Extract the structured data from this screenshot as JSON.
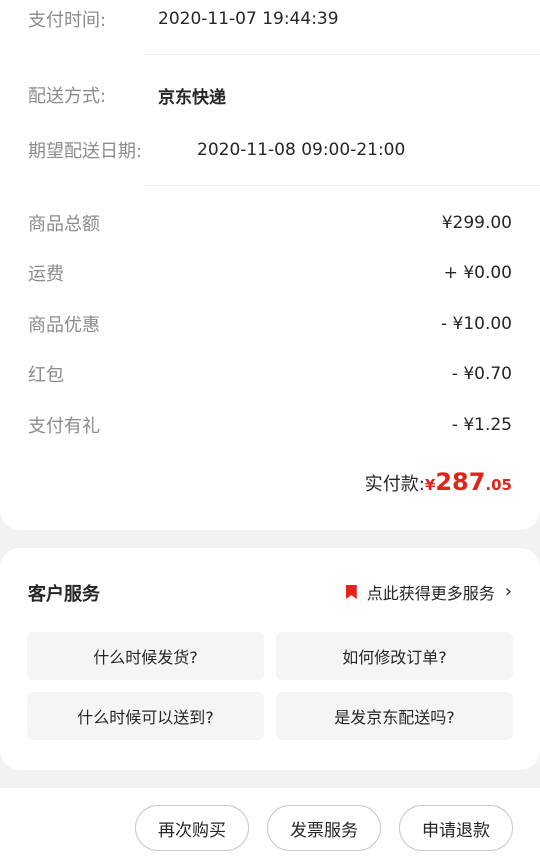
{
  "order": {
    "pay_time_label": "支付时间:",
    "pay_time": "2020-11-07 19:44:39",
    "delivery_method_label": "配送方式:",
    "delivery_method": "京东快递",
    "expected_date_label": "期望配送日期:",
    "expected_date": "2020-11-08 09:00-21:00"
  },
  "amounts": [
    {
      "label": "商品总额",
      "value": "¥299.00"
    },
    {
      "label": "运费",
      "value": "+ ¥0.00"
    },
    {
      "label": "商品优惠",
      "value": "- ¥10.00"
    },
    {
      "label": "红包",
      "value": "- ¥0.70"
    },
    {
      "label": "支付有礼",
      "value": "- ¥1.25"
    }
  ],
  "paid": {
    "label": "实付款:",
    "currency": "¥",
    "integer": "287",
    "decimal": ".05"
  },
  "service": {
    "title": "客户服务",
    "more": "点此获得更多服务",
    "chevron": "›",
    "questions": [
      "什么时候发货?",
      "如何修改订单?",
      "什么时候可以送到?",
      "是发京东配送吗?"
    ]
  },
  "actions": {
    "rebuy": "再次购买",
    "invoice": "发票服务",
    "refund": "申请退款"
  },
  "colors": {
    "accent": "#e2231a",
    "card": "#ffffff",
    "background": "#f2f2f2"
  }
}
